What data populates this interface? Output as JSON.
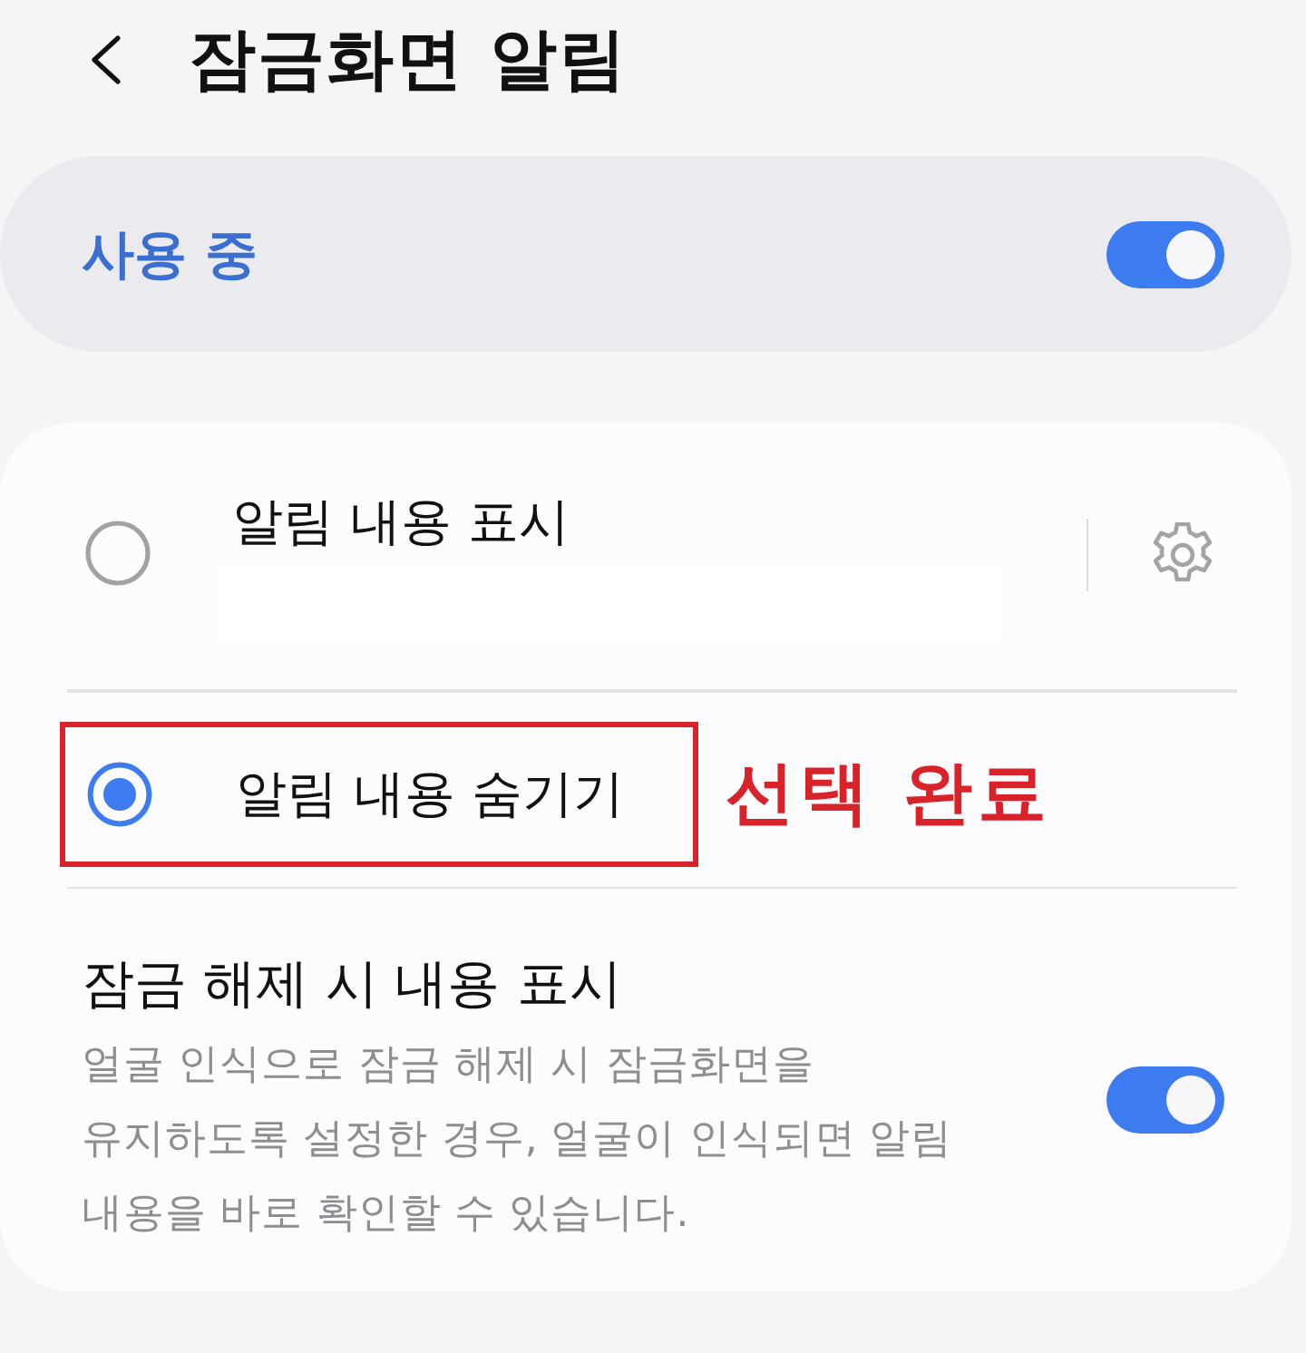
{
  "header": {
    "title": "잠금화면 알림"
  },
  "master_switch": {
    "label": "사용 중",
    "on": true
  },
  "options": [
    {
      "kind": "settings",
      "label": "알림 내용 표시",
      "selected": false,
      "highlighted": false
    },
    {
      "kind": "plain",
      "label": "알림 내용 숨기기",
      "selected": true,
      "highlighted": true
    }
  ],
  "annotation": {
    "text": "선택 완료"
  },
  "unlock_setting": {
    "title": "잠금 해제 시 내용 표시",
    "description": "얼굴 인식으로 잠금 해제 시 잠금화면을 유지하도록 설정한 경우, 얼굴이 인식되면 알림 내용을 바로 확인할 수 있습니다.",
    "on": true
  }
}
